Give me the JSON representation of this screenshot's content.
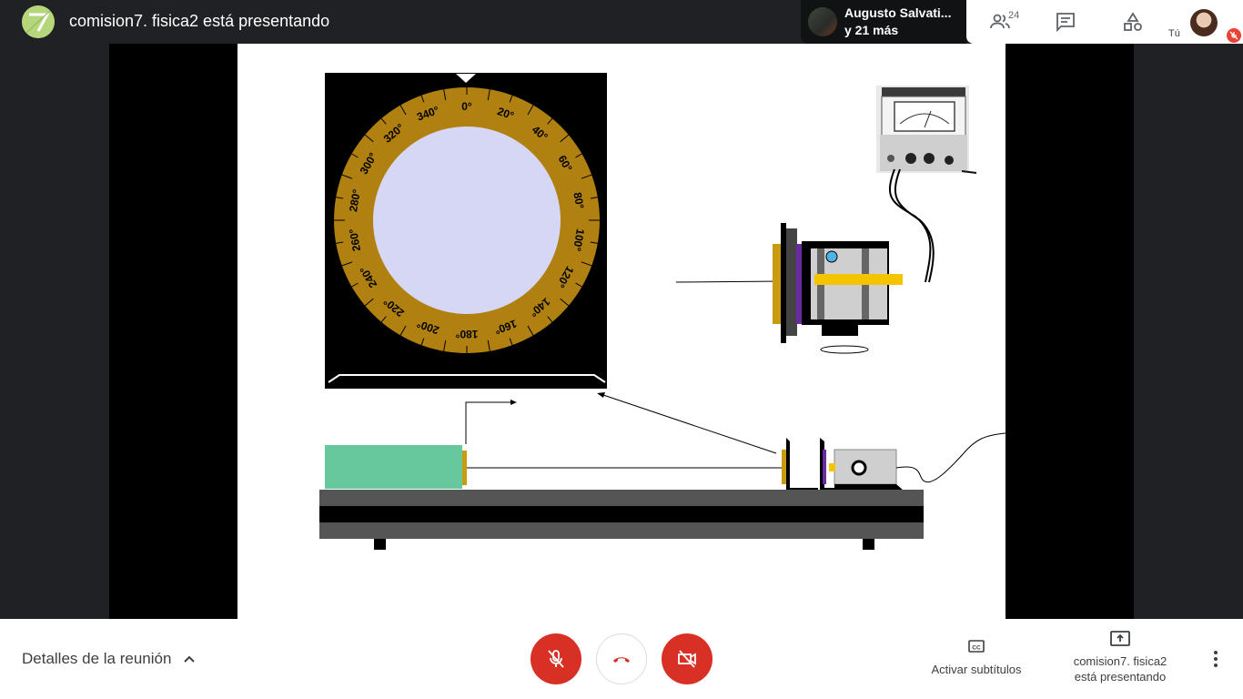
{
  "topbar": {
    "presenter_title": "comision7. fisica2 está presentando",
    "participant_name": "Augusto Salvati...",
    "participant_more": "y 21 más",
    "people_count": "24",
    "you_label": "Tú"
  },
  "slide": {
    "dial_labels": [
      "0°",
      "20°",
      "40°",
      "60°",
      "80°",
      "100°",
      "120°",
      "140°",
      "160°",
      "180°",
      "200°",
      "220°",
      "240°",
      "260°",
      "280°",
      "300°",
      "320°",
      "340°"
    ],
    "dial_color": "#b08010",
    "dial_face_color": "#d6d6f5"
  },
  "bottombar": {
    "meeting_details": "Detalles de la reunión",
    "captions_label": "Activar subtítulos",
    "present_line1": "comision7. fisica2",
    "present_line2": "está presentando"
  },
  "colors": {
    "danger": "#d93025",
    "background": "#202124"
  }
}
